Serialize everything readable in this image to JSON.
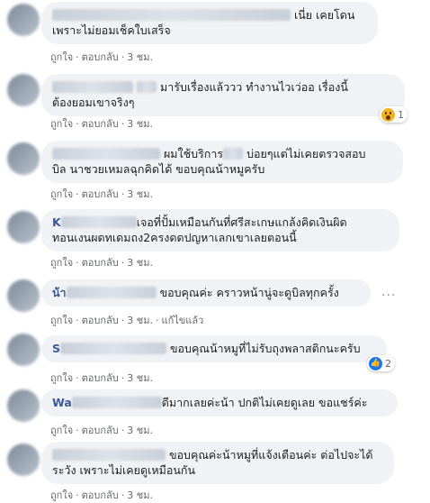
{
  "actions": {
    "like": "ถูกใจ",
    "reply": "ตอบกลับ",
    "edited": "แก้ไขแล้ว"
  },
  "comments": [
    {
      "pre": "",
      "name": "",
      "post": "เนี่ย เคยโดน",
      "line2": "เพราะไม่ยอมเช็คใบเสร็จ",
      "time": "3 ชม."
    },
    {
      "pre": "",
      "name": "",
      "post": "มารับเรื่องแล้ววว ทำงานไวเว่ออ เรื่องนี้",
      "line2": "ต้องยอมเขาจริงๆ",
      "time": "3 ชม.",
      "reaction": {
        "icon": "wow-icon",
        "count": "1"
      }
    },
    {
      "pre": "",
      "name": "",
      "post": "ผมใช้บริการ",
      "post2": "บ่อยๆแต่ไม่เคยตรวจสอบ",
      "line2": "บิล นาชวยเหมลฉุกคิดได้ ขอบคุณน้าหมูครับ",
      "time": "3 ชม."
    },
    {
      "pre": "",
      "name": "K",
      "post": "เจอที่ปั้มเหมือนกันที่ศรีสะเกษแกล้งคิดเงินผิด",
      "line2": "ทอนเงนผดทเดมถง2ครงดดปญหาเลกเขาเลยตอนนี้",
      "time": "3 ชม."
    },
    {
      "pre": "",
      "name": "น้า",
      "post": "ขอบคุณค่ะ คราวหน้านู่จะดูบิลทุกครั้ง",
      "line2": "",
      "time": "3 ชม.",
      "edited": true,
      "more": "···"
    },
    {
      "pre": "",
      "name": "S",
      "post": "ขอบคุณน้าหมูที่ไม่รับถุงพลาสติกนะครับ",
      "line2": "",
      "time": "3 ชม.",
      "reaction": {
        "icon": "like-icon",
        "count": "2"
      }
    },
    {
      "pre": "",
      "name": "Wa",
      "post": "ดีมากเลยค่ะน้า ปกติไม่เคยดูเลย ขอแชร์ค่ะ",
      "line2": "",
      "time": "3 ชม."
    },
    {
      "pre": "",
      "name": "",
      "post": "ขอบคุณค่ะน้าหมูที่แจ้งเตือนค่ะ ต่อไปจะได้",
      "line2": "ระวัง เพราะไม่เคยดูเหมือนกัน",
      "time": "3 ชม."
    }
  ],
  "colors": {
    "bubble": "#f0f2f5",
    "name": "#385898",
    "meta": "#65676b"
  }
}
